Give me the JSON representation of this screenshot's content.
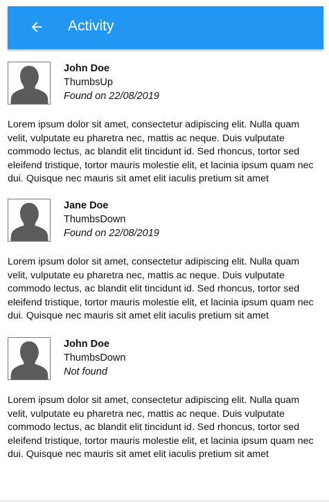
{
  "header": {
    "title": "Activity",
    "back_icon": "arrow-left-icon",
    "color": "#2196f3"
  },
  "activities": [
    {
      "name": "John Doe",
      "reaction": "ThumbsUp",
      "found": "Found on 22/08/2019",
      "body": "Lorem ipsum dolor sit amet, consectetur adipiscing elit. Nulla quam velit, vulputate eu pharetra nec, mattis ac neque. Duis vulputate commodo lectus, ac blandit elit tincidunt id. Sed rhoncus, tortor sed eleifend tristique, tortor mauris molestie elit, et lacinia ipsum quam nec dui. Quisque nec mauris sit amet elit iaculis pretium sit amet"
    },
    {
      "name": "Jane Doe",
      "reaction": "ThumbsDown",
      "found": "Found on 22/08/2019",
      "body": "Lorem ipsum dolor sit amet, consectetur adipiscing elit. Nulla quam velit, vulputate eu pharetra nec, mattis ac neque. Duis vulputate commodo lectus, ac blandit elit tincidunt id. Sed rhoncus, tortor sed eleifend tristique, tortor mauris molestie elit, et lacinia ipsum quam nec dui. Quisque nec mauris sit amet elit iaculis pretium sit amet"
    },
    {
      "name": "John Doe",
      "reaction": "ThumbsDown",
      "found": "Not found",
      "body": "Lorem ipsum dolor sit amet, consectetur adipiscing elit. Nulla quam velit, vulputate eu pharetra nec, mattis ac neque. Duis vulputate commodo lectus, ac blandit elit tincidunt id. Sed rhoncus, tortor sed eleifend tristique, tortor mauris molestie elit, et lacinia ipsum quam nec dui. Quisque nec mauris sit amet elit iaculis pretium sit amet"
    }
  ]
}
